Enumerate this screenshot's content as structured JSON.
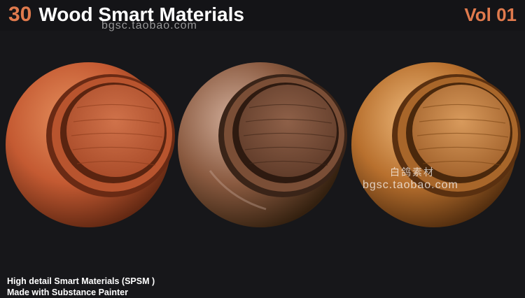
{
  "header": {
    "number": "30",
    "title": "Wood Smart Materials",
    "volume": "Vol 01"
  },
  "watermarks": {
    "top_url": "bgsc.taobao.com",
    "mid_cn": "白鸽素材",
    "mid_url": "bgsc.taobao.com"
  },
  "materials": [
    {
      "name": "red-wood-sphere",
      "base": "#c45a32",
      "light": "#e08a5a",
      "dark": "#6a2a14"
    },
    {
      "name": "weathered-wood-sphere",
      "base": "#8a5a40",
      "light": "#c9a08a",
      "dark": "#3e2417"
    },
    {
      "name": "golden-wood-sphere",
      "base": "#b8702e",
      "light": "#e8b070",
      "dark": "#5a3010"
    }
  ],
  "footer": {
    "line1": "High detail Smart Materials (SPSM )",
    "line2": "Made with Substance Painter"
  }
}
